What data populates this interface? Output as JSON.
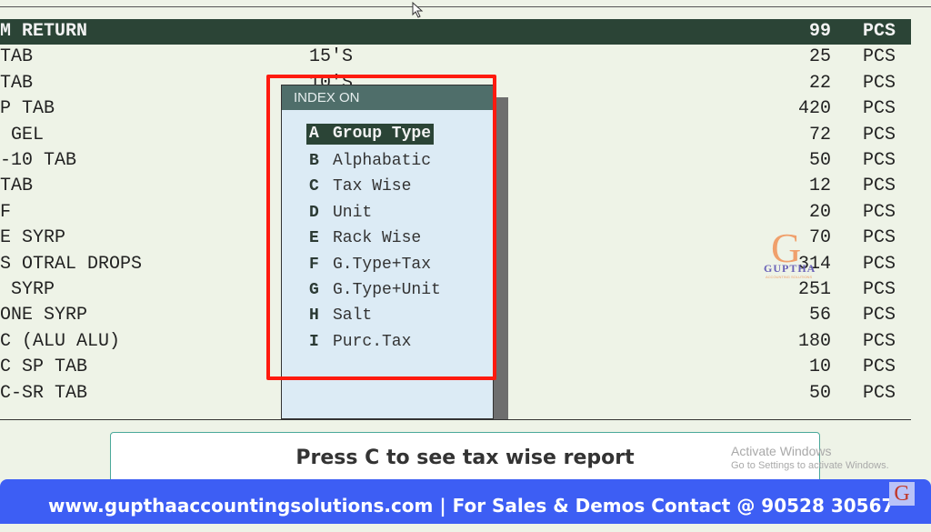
{
  "list": {
    "rows": [
      {
        "name": "M RETURN",
        "pack": "",
        "qty": "99",
        "unit": "PCS",
        "selected": true
      },
      {
        "name": "TAB",
        "pack": "15'S",
        "qty": "25",
        "unit": "PCS"
      },
      {
        "name": "TAB",
        "pack": "10'S",
        "qty": "22",
        "unit": "PCS"
      },
      {
        "name": "P TAB",
        "pack": "",
        "qty": "420",
        "unit": "PCS"
      },
      {
        "name": " GEL",
        "pack": "",
        "qty": "72",
        "unit": "PCS"
      },
      {
        "name": "-10 TAB",
        "pack": "",
        "qty": "50",
        "unit": "PCS"
      },
      {
        "name": "TAB",
        "pack": "",
        "qty": "12",
        "unit": "PCS"
      },
      {
        "name": "F",
        "pack": "",
        "qty": "20",
        "unit": "PCS"
      },
      {
        "name": "E SYRP",
        "pack": "",
        "qty": "70",
        "unit": "PCS"
      },
      {
        "name": "S OTRAL DROPS",
        "pack": "",
        "qty": "314",
        "unit": "PCS"
      },
      {
        "name": " SYRP",
        "pack": "",
        "qty": "251",
        "unit": "PCS"
      },
      {
        "name": "ONE SYRP",
        "pack": "",
        "qty": "56",
        "unit": "PCS"
      },
      {
        "name": "C (ALU ALU)",
        "pack": "",
        "qty": "180",
        "unit": "PCS"
      },
      {
        "name": "C SP TAB",
        "pack": "",
        "qty": "10",
        "unit": "PCS"
      },
      {
        "name": "C-SR TAB",
        "pack": "",
        "qty": "50",
        "unit": "PCS"
      }
    ]
  },
  "popup": {
    "title": "INDEX ON",
    "items": [
      {
        "key": "A",
        "label": "Group Type",
        "selected": true
      },
      {
        "key": "B",
        "label": "Alphabatic"
      },
      {
        "key": "C",
        "label": "Tax Wise"
      },
      {
        "key": "D",
        "label": "Unit"
      },
      {
        "key": "E",
        "label": "Rack Wise"
      },
      {
        "key": "F",
        "label": "G.Type+Tax"
      },
      {
        "key": "G",
        "label": "G.Type+Unit"
      },
      {
        "key": "H",
        "label": "Salt"
      },
      {
        "key": "I",
        "label": "Purc.Tax"
      }
    ]
  },
  "watermark": {
    "letter": "G",
    "brand": "GUPTHA",
    "sub": "ACCOUNTING SOLUTIONS"
  },
  "caption": "Press C to see tax wise report",
  "activate_windows": {
    "title": "Activate Windows",
    "subtitle": "Go to Settings to activate Windows."
  },
  "footer": {
    "text": "www.gupthaaccountingsolutions.com | For Sales & Demos Contact @ 90528 30567",
    "logo_letter": "G"
  },
  "colors": {
    "selection": "#2b4436",
    "highlight": "#ff1a0f",
    "footer": "#3d5ef4",
    "popup_bg": "#dcebf5"
  }
}
